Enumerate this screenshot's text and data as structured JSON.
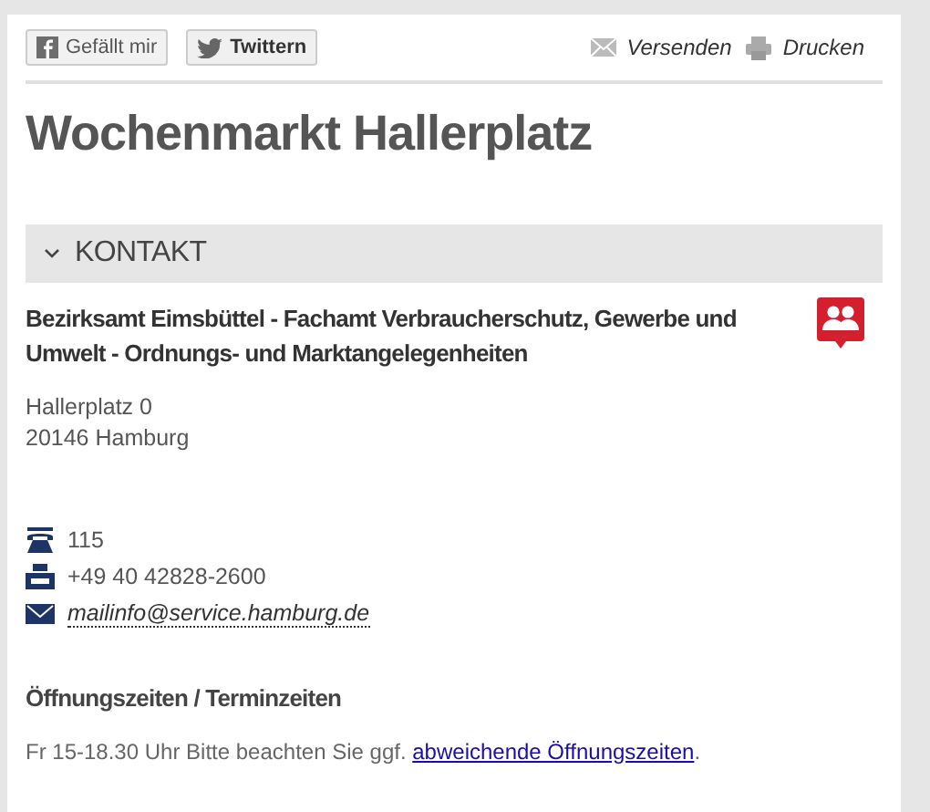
{
  "share_buttons": [
    {
      "kind": "facebook",
      "label": "Gefällt mir"
    },
    {
      "kind": "twitter",
      "label": "Twittern"
    }
  ],
  "actions": [
    {
      "kind": "mail",
      "label": "Versenden"
    },
    {
      "kind": "print",
      "label": "Drucken"
    }
  ],
  "title": "Wochenmarkt Hallerplatz",
  "section": {
    "title": "KONTAKT",
    "expanded": true,
    "organization": "Bezirksamt Eimsbüttel - Fachamt Verbraucherschutz, Gewerbe und Umwelt - Ordnungs- und Marktangelegenheiten",
    "address": [
      "Hallerplatz 0",
      "20146 Hamburg"
    ],
    "contacts": [
      {
        "kind": "phone",
        "text": "115"
      },
      {
        "kind": "fax",
        "text": "+49 40 42828-2600"
      },
      {
        "kind": "email",
        "text": "mailinfo@service.hamburg.de"
      }
    ],
    "hours_heading": "Öffnungszeiten / Terminzeiten",
    "hours_text": "Fr 15-18.30 Uhr Bitte beachten Sie ggf.",
    "hours_link": "abweichende Öffnungszeiten",
    "hours_end": "."
  }
}
